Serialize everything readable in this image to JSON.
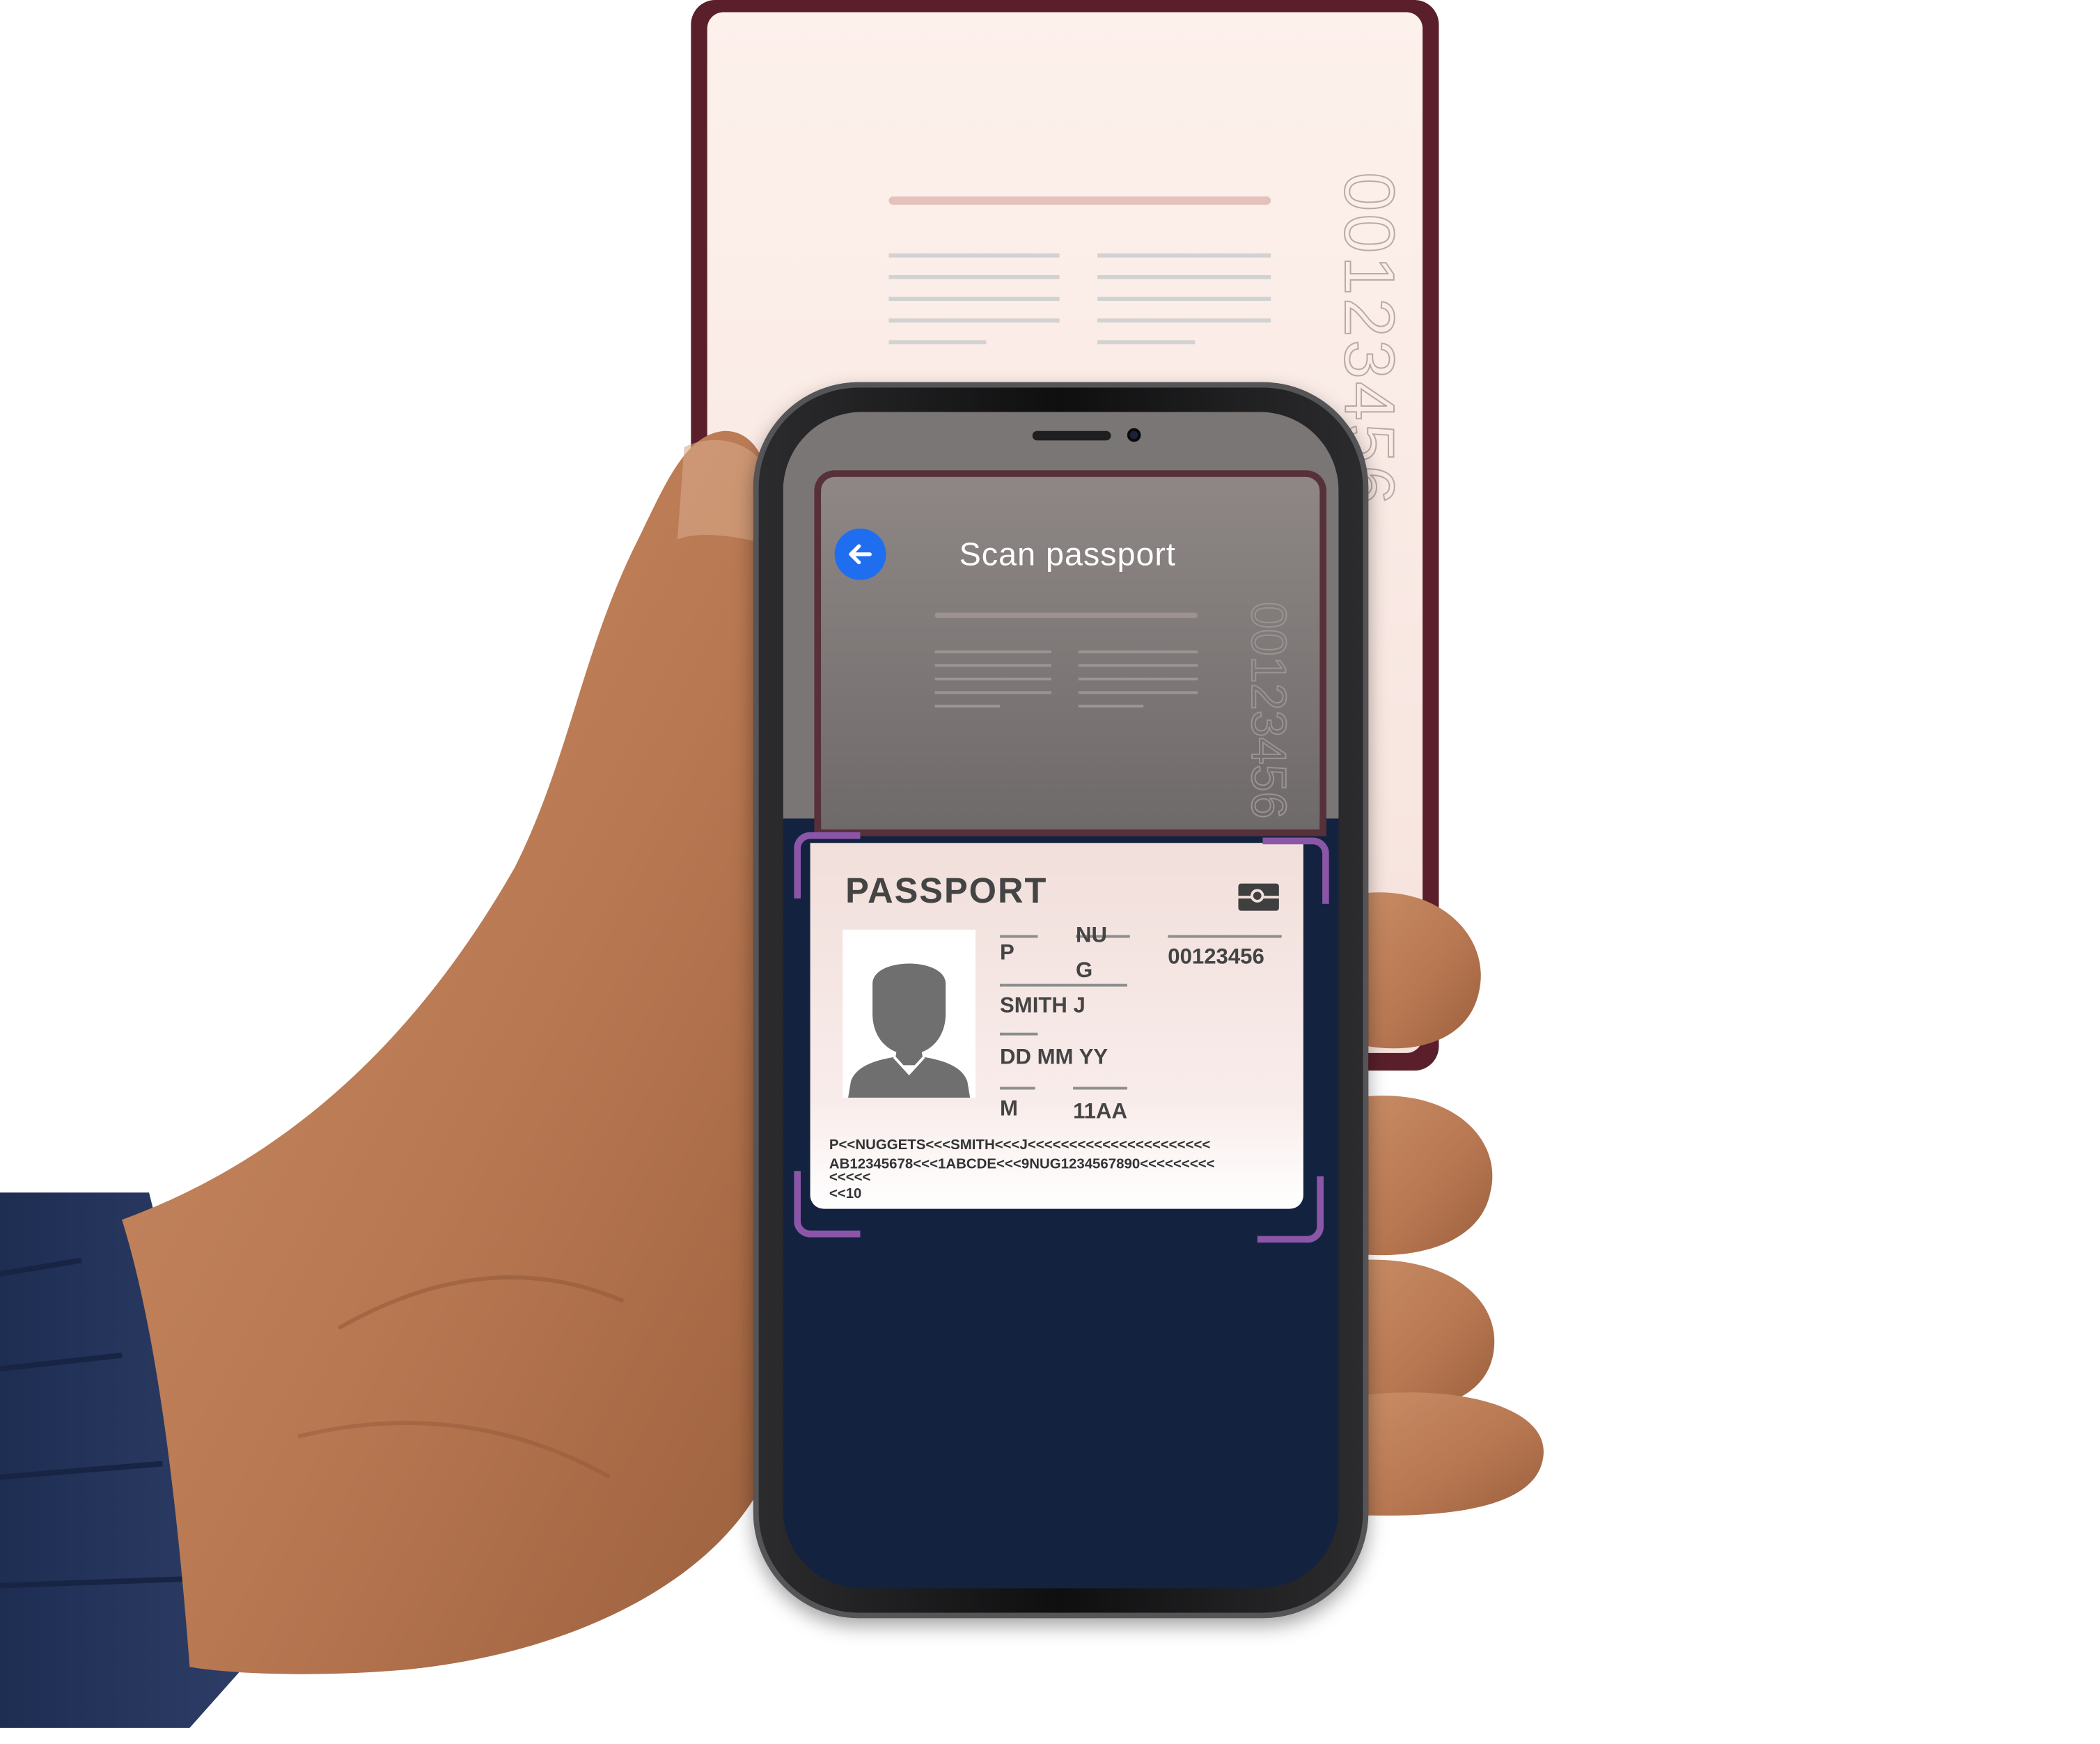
{
  "booklet": {
    "document_number": "00123456"
  },
  "screen": {
    "title": "Scan passport",
    "back_icon": "arrow-left-icon",
    "accent_color": "#1f6ef0",
    "frame_color": "#8b56a8"
  },
  "passport": {
    "heading": "PASSPORT",
    "chip_icon": "e-passport-chip-icon",
    "photo_icon": "person-silhouette-icon",
    "type_code": "P",
    "country_code": "NU",
    "country_code_suffix": "G",
    "document_number": "00123456",
    "name": "SMITH J",
    "date_of_birth": "DD MM YY",
    "sex": "M",
    "code": "11AA",
    "mrz_line_1": "P<<NUGGETS<<<SMITH<<<J<<<<<<<<<<<<<<<<<<<<<<",
    "mrz_line_2": "AB12345678<<<1ABCDE<<<9NUG1234567890<<<<<<<<<",
    "mrz_line_3": "<<<<<",
    "mrz_line_4": "<<10"
  }
}
